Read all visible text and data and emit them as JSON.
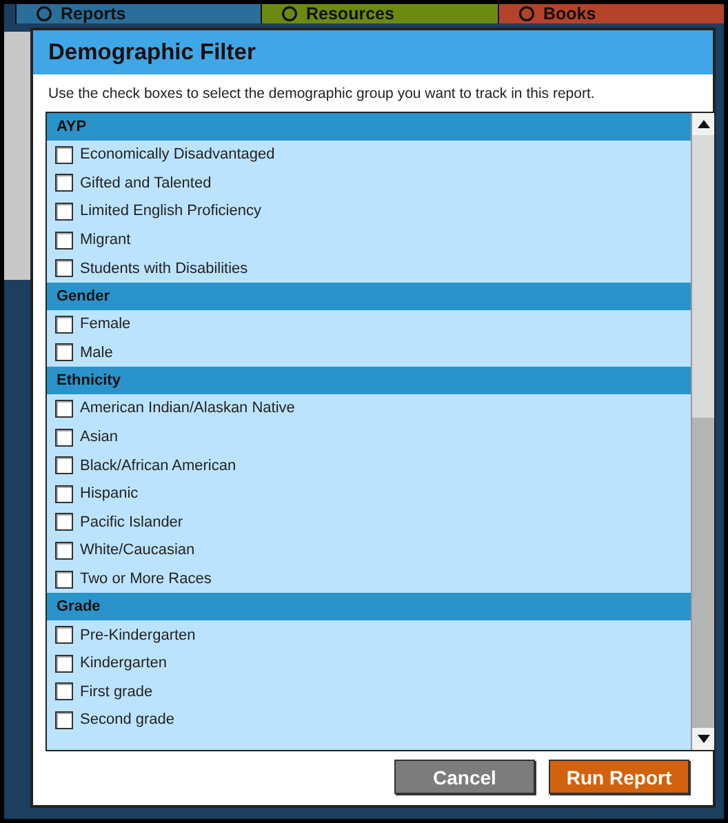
{
  "background_tabs": [
    {
      "label": "Reports",
      "color": "#2a6e9a"
    },
    {
      "label": "Resources",
      "color": "#6d8a10"
    },
    {
      "label": "Books",
      "color": "#b5432a"
    }
  ],
  "dialog": {
    "title": "Demographic Filter",
    "instructions": "Use the check boxes to select the demographic group you want to track in this report.",
    "groups": [
      {
        "heading": "AYP",
        "options": [
          {
            "label": "Economically Disadvantaged",
            "checked": false
          },
          {
            "label": "Gifted and Talented",
            "checked": false
          },
          {
            "label": "Limited English Proficiency",
            "checked": false
          },
          {
            "label": "Migrant",
            "checked": false
          },
          {
            "label": "Students with Disabilities",
            "checked": false
          }
        ]
      },
      {
        "heading": "Gender",
        "options": [
          {
            "label": "Female",
            "checked": false
          },
          {
            "label": "Male",
            "checked": false
          }
        ]
      },
      {
        "heading": "Ethnicity",
        "options": [
          {
            "label": "American Indian/Alaskan Native",
            "checked": false
          },
          {
            "label": "Asian",
            "checked": false
          },
          {
            "label": "Black/African American",
            "checked": false
          },
          {
            "label": "Hispanic",
            "checked": false
          },
          {
            "label": "Pacific Islander",
            "checked": false
          },
          {
            "label": "White/Caucasian",
            "checked": false
          },
          {
            "label": "Two or More Races",
            "checked": false
          }
        ]
      },
      {
        "heading": "Grade",
        "options": [
          {
            "label": "Pre-Kindergarten",
            "checked": false
          },
          {
            "label": "Kindergarten",
            "checked": false
          },
          {
            "label": "First grade",
            "checked": false
          },
          {
            "label": "Second grade",
            "checked": false
          }
        ]
      }
    ],
    "buttons": [
      {
        "label": "Cancel",
        "kind": "secondary"
      },
      {
        "label": "Run Report",
        "kind": "primary"
      }
    ]
  }
}
